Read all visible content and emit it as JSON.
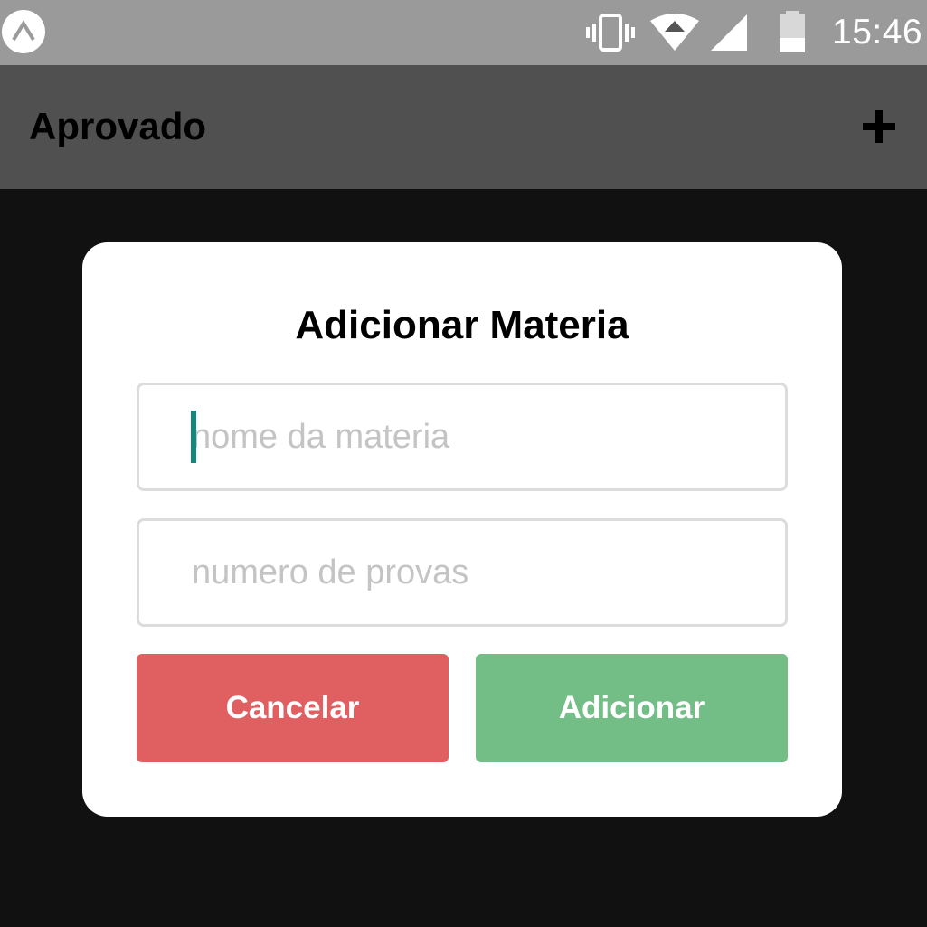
{
  "status_bar": {
    "time": "15:46",
    "icons": [
      "expo-logo-icon",
      "vibrate-icon",
      "wifi-icon",
      "signal-icon",
      "battery-icon"
    ]
  },
  "header": {
    "title": "Aprovado",
    "add_icon": "plus-icon"
  },
  "modal": {
    "title": "Adicionar Materia",
    "subject_field": {
      "value": "",
      "placeholder": "nome da materia",
      "focused": true
    },
    "exams_field": {
      "value": "",
      "placeholder": "numero de provas"
    },
    "cancel_label": "Cancelar",
    "submit_label": "Adicionar"
  },
  "colors": {
    "status_bar": "#9a9a9a",
    "header": "#505050",
    "backdrop": "#111111",
    "cancel": "#e06062",
    "submit": "#72be86",
    "caret": "#0e8a7e"
  }
}
